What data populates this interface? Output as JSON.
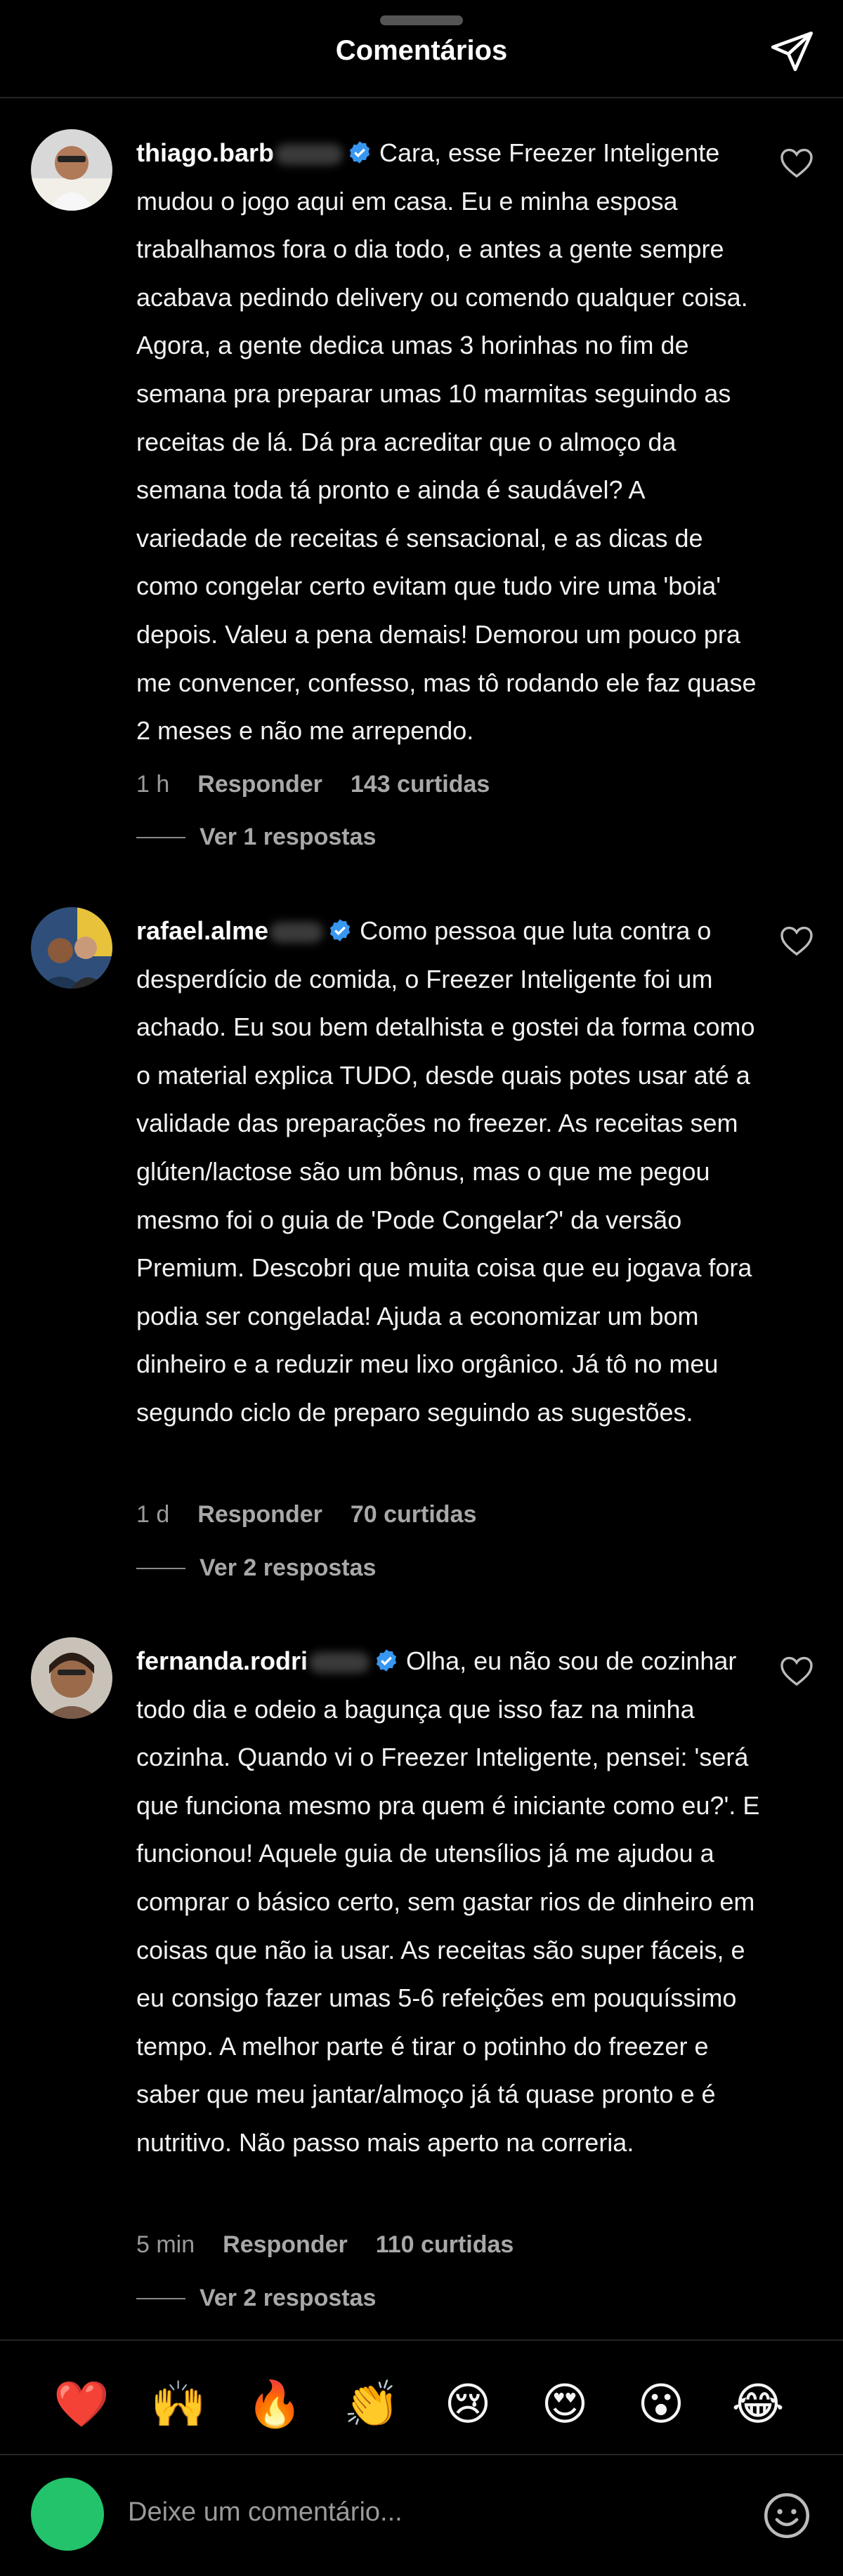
{
  "header": {
    "title": "Comentários",
    "send_icon": "send-icon"
  },
  "comments": [
    {
      "username": "thiago.barb",
      "text": "Cara, esse Freezer Inteligente mudou o jogo aqui em casa. Eu e minha esposa trabalhamos fora o dia todo, e antes a gente sempre acabava pedindo delivery ou comendo qualquer coisa. Agora, a gente dedica umas 3 horinhas no fim de semana pra preparar umas 10 marmitas seguindo as receitas de lá. Dá pra acreditar que o almoço da semana toda tá pronto e ainda é saudável? A variedade de receitas é sensacional, e as dicas de como congelar certo evitam que tudo vire uma 'boia' depois. Valeu a pena demais! Demorou um pouco pra me convencer, confesso, mas tô rodando ele faz quase 2 meses e não me arrependo.",
      "time": "1 h",
      "reply": "Responder",
      "likes": "143 curtidas",
      "replies": "Ver 1 respostas"
    },
    {
      "username": "rafael.alme",
      "text": "Como pessoa que luta contra o desperdício de comida, o Freezer Inteligente foi um achado. Eu sou bem detalhista e gostei da forma como o material explica TUDO, desde quais potes usar até a validade das preparações no freezer. As receitas sem glúten/lactose são um bônus, mas o que me pegou mesmo foi o guia de 'Pode Congelar?' da versão Premium. Descobri que muita coisa que eu jogava fora podia ser congelada! Ajuda a economizar um bom dinheiro e a reduzir meu lixo orgânico. Já tô no meu segundo ciclo de preparo seguindo as sugestões.",
      "time": "1 d",
      "reply": "Responder",
      "likes": "70 curtidas",
      "replies": "Ver 2 respostas"
    },
    {
      "username": "fernanda.rodri",
      "text": "Olha, eu não sou de cozinhar todo dia e odeio a bagunça que isso faz na minha cozinha. Quando vi o Freezer Inteligente, pensei: 'será que funciona mesmo pra quem é iniciante como eu?'. E funcionou! Aquele guia de utensílios já me ajudou a comprar o básico certo, sem gastar rios de dinheiro em coisas que não ia usar. As receitas são super fáceis, e eu consigo fazer umas 5-6 refeições em pouquíssimo tempo. A melhor parte é tirar o potinho do freezer e saber que meu jantar/almoço já tá quase pronto e é nutritivo. Não passo mais aperto na correria.",
      "time": "5 min",
      "reply": "Responder",
      "likes": "110 curtidas",
      "replies": "Ver 2 respostas"
    }
  ],
  "reactions": [
    "❤️",
    "🙌",
    "🔥",
    "👏",
    "😢",
    "😍",
    "😮",
    "😂"
  ],
  "input": {
    "placeholder": "Deixe um comentário..."
  },
  "colors": {
    "background": "#000000",
    "verified": "#3897f0",
    "my_avatar": "#22c36a"
  }
}
